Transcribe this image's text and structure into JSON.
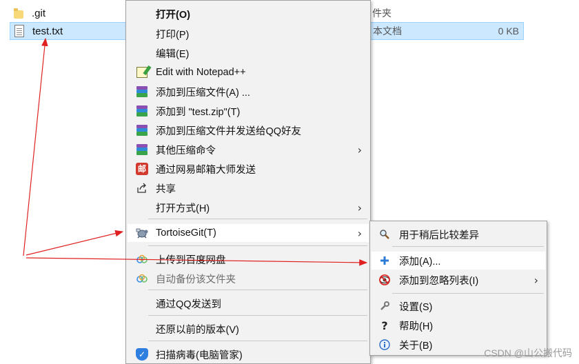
{
  "files": [
    {
      "name": ".git",
      "type": "件夹",
      "size": "",
      "icon": "folder-icon",
      "selected": false
    },
    {
      "name": "test.txt",
      "type": "本文档",
      "size": "0 KB",
      "icon": "text-file-icon",
      "selected": true
    }
  ],
  "context_menu": {
    "items": [
      {
        "label": "打开(O)",
        "icon": ""
      },
      {
        "label": "打印(P)",
        "icon": ""
      },
      {
        "label": "编辑(E)",
        "icon": ""
      },
      {
        "label": "Edit with Notepad++",
        "icon": "notepad-plus-plus-icon"
      },
      {
        "label": "添加到压缩文件(A) ...",
        "icon": "winrar-icon"
      },
      {
        "label": "添加到 \"test.zip\"(T)",
        "icon": "winrar-icon"
      },
      {
        "label": "添加到压缩文件并发送给QQ好友",
        "icon": "winrar-icon"
      },
      {
        "label": "其他压缩命令",
        "icon": "winrar-icon"
      },
      {
        "label": "通过网易邮箱大师发送",
        "icon": "netease-mail-icon",
        "icon_text": "邮"
      },
      {
        "label": "共享",
        "icon": "share-icon"
      },
      {
        "label": "打开方式(H)",
        "icon": ""
      },
      {
        "label": "TortoiseGit(T)",
        "icon": "tortoisegit-icon"
      },
      {
        "label": "上传到百度网盘",
        "icon": "baidu-cloud-icon"
      },
      {
        "label": "自动备份该文件夹",
        "icon": "baidu-cloud-icon"
      },
      {
        "label": "通过QQ发送到",
        "icon": ""
      },
      {
        "label": "还原以前的版本(V)",
        "icon": ""
      },
      {
        "label": "扫描病毒(电脑管家)",
        "icon": "pc-manager-shield-icon"
      }
    ]
  },
  "submenu": {
    "items": [
      {
        "label": "用于稍后比较差异",
        "icon": "magnifier-icon"
      },
      {
        "label": "添加(A)...",
        "icon": "add-plus-icon"
      },
      {
        "label": "添加到忽略列表(I)",
        "icon": "ignore-icon"
      },
      {
        "label": "设置(S)",
        "icon": "wrench-icon"
      },
      {
        "label": "帮助(H)",
        "icon": "help-icon"
      },
      {
        "label": "关于(B)",
        "icon": "info-icon"
      }
    ]
  },
  "watermark": "CSDN @山公搬代码",
  "colors": {
    "selection": "#cce8ff",
    "menu_bg": "#f2f2f2",
    "annotation_arrow": "#e02020",
    "add_icon": "#2a7ad6"
  }
}
